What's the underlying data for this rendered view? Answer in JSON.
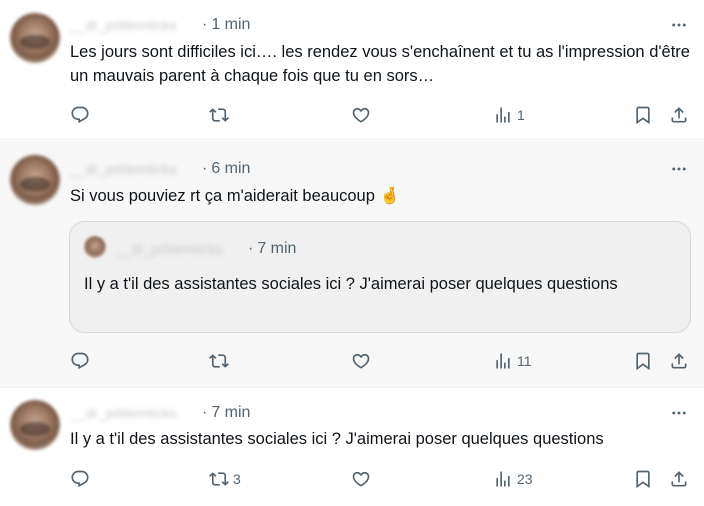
{
  "tweets": [
    {
      "handle": "__dr_prblemticks",
      "time": "1 min",
      "text": "Les jours sont difficiles ici…. les rendez vous s'enchaînent et tu as l'impression d'être un mauvais parent à chaque fois que tu en sors…",
      "counts": {
        "reply": "",
        "retweet": "",
        "like": "",
        "views": "1"
      }
    },
    {
      "handle": "__dr_prblemticks",
      "time": "6 min",
      "text": "Si vous pouviez rt ça m'aiderait beaucoup 🤞",
      "quote": {
        "handle": "__dr_prblemticks",
        "time": "7 min",
        "text": "Il y a t'il des assistantes sociales ici ? J'aimerai poser quelques questions"
      },
      "counts": {
        "reply": "",
        "retweet": "",
        "like": "",
        "views": "11"
      }
    },
    {
      "handle": "__dr_prblemticks",
      "time": "7 min",
      "text": "Il y a t'il des assistantes sociales ici ? J'aimerai poser quelques questions",
      "counts": {
        "reply": "",
        "retweet": "3",
        "like": "",
        "views": "23"
      }
    }
  ],
  "separator": "·",
  "icons": [
    "reply-icon",
    "retweet-icon",
    "like-icon",
    "views-icon",
    "bookmark-icon",
    "share-icon",
    "more-icon"
  ]
}
